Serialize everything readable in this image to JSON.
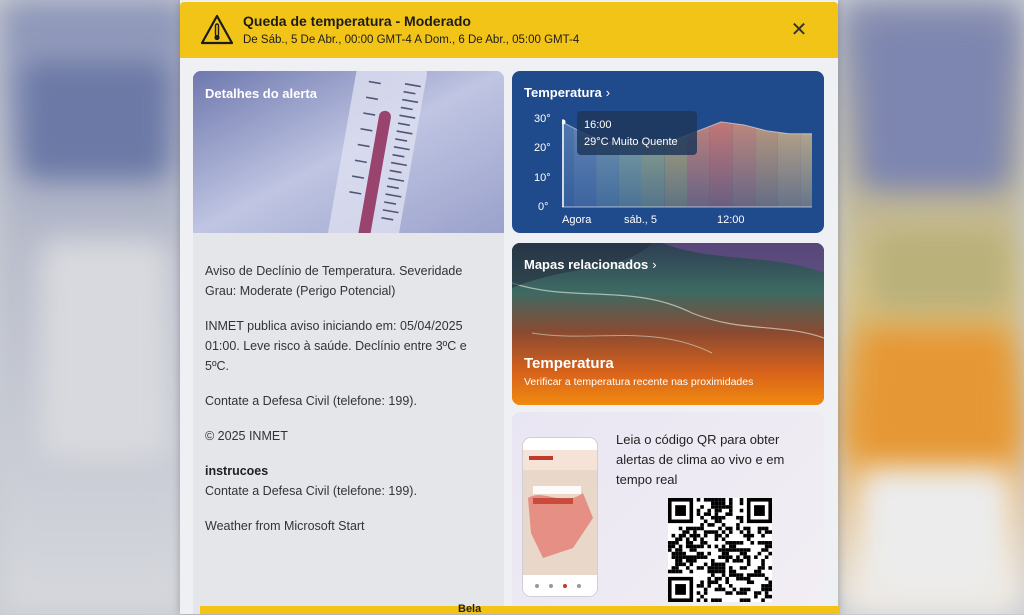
{
  "alert": {
    "title": "Queda de temperatura - Moderado",
    "subtitle": "De Sáb., 5 De Abr., 00:00 GMT-4 A Dom., 6 De Abr., 05:00 GMT-4",
    "close_label": "✕",
    "bar_color": "#f2c418"
  },
  "details": {
    "title": "Detalhes do alerta",
    "paragraphs": [
      "Aviso de Declínio de Temperatura. Severidade Grau: Moderate (Perigo Potencial)",
      "INMET publica aviso iniciando em: 05/04/2025 01:00. Leve risco à saúde. Declínio entre 3ºC e 5ºC.",
      "Contate a Defesa Civil (telefone: 199).",
      "© 2025 INMET"
    ],
    "instructions_heading": "instrucoes",
    "instructions_text": "Contate a Defesa Civil (telefone: 199).",
    "attribution": "Weather from Microsoft Start"
  },
  "temperature": {
    "title": "Temperatura",
    "chevron": "›",
    "y_ticks": [
      "30°",
      "20°",
      "10°",
      "0°"
    ],
    "x_ticks": [
      "Agora",
      "sáb., 5",
      "12:00"
    ],
    "tooltip_time": "16:00",
    "tooltip_value": "29°C Muito Quente",
    "card_color": "#1f4a8c"
  },
  "chart_data": {
    "type": "area",
    "title": "Temperatura",
    "xlabel": "",
    "ylabel": "",
    "ylim": [
      0,
      30
    ],
    "x_ticks": [
      "Agora",
      "sáb., 5",
      "12:00"
    ],
    "series": [
      {
        "values": [
          29,
          25,
          22,
          22,
          22,
          23,
          26,
          29,
          28,
          26,
          25,
          25
        ]
      }
    ],
    "grid": false
  },
  "maps": {
    "title": "Mapas relacionados",
    "chevron": "›",
    "heading": "Temperatura",
    "subtitle": "Verificar a temperatura recente nas proximidades"
  },
  "qr": {
    "text": "Leia o código QR para obter alertas de clima ao vivo e em tempo real"
  },
  "taskbar": {
    "label": "Bela"
  },
  "icons": {
    "warning": "warning-thermometer-icon",
    "close": "close-icon",
    "chevron": "chevron-right-icon"
  }
}
